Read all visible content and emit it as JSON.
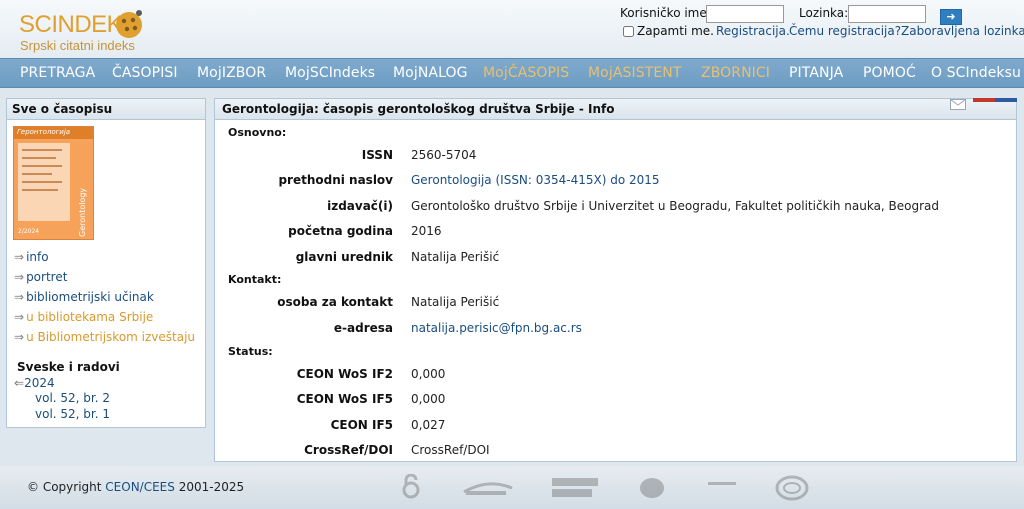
{
  "header": {
    "logo_main": "SCINDEKS",
    "logo_sub": "Srpski citatni indeks",
    "username_label": "Korisničko ime:",
    "password_label": "Lozinka:",
    "remember_label": "Zapamti me.",
    "links": [
      "Registracija.",
      "Čemu registracija?",
      "Zaboravljena lozinka!"
    ]
  },
  "nav": {
    "items": [
      {
        "label": "PRETRAGA"
      },
      {
        "label": "ČASOPISI"
      },
      {
        "label": "MojIZBOR"
      },
      {
        "label": "MojSCIndeks"
      },
      {
        "label": "MojNALOG"
      },
      {
        "label": "MojČASOPIS"
      },
      {
        "label": "MojASISTENT"
      },
      {
        "label": "ZBORNICI"
      },
      {
        "label": "PITANJA"
      },
      {
        "label": "POMOĆ"
      },
      {
        "label": "O SCIndeksu"
      }
    ]
  },
  "sidebar": {
    "title": "Sve o časopisu",
    "cover": {
      "title": "Геронтологија",
      "vertical": "Gerontology",
      "year": "2/2024"
    },
    "links": [
      {
        "label": "info"
      },
      {
        "label": "portret"
      },
      {
        "label": "bibliometrijski učinak"
      },
      {
        "label": "u bibliotekama Srbije"
      },
      {
        "label": "u Bibliometrijskom izveštaju"
      }
    ],
    "issues_heading": "Sveske i radovi",
    "year": "2024",
    "volumes": [
      "vol. 52, br. 2",
      "vol. 52, br. 1"
    ]
  },
  "main": {
    "title": "Gerontologija: časopis gerontološkog društva Srbije - Info",
    "sections": {
      "basic": "Osnovno:",
      "contact": "Kontakt:",
      "status": "Status:"
    },
    "rows": {
      "issn": {
        "label": "ISSN",
        "value": "2560-5704"
      },
      "prev_title": {
        "label": "prethodni naslov",
        "value": "Gerontologija (ISSN: 0354-415X) do 2015"
      },
      "publisher": {
        "label": "izdavač(i)",
        "value": "Gerontološko društvo Srbije i Univerzitet u Beogradu, Fakultet političkih nauka, Beograd"
      },
      "start_year": {
        "label": "početna godina",
        "value": "2016"
      },
      "editor": {
        "label": "glavni urednik",
        "value": "Natalija Perišić"
      },
      "contact_person": {
        "label": "osoba za kontakt",
        "value": "Natalija Perišić"
      },
      "email": {
        "label": "e-adresa",
        "value": "natalija.perisic@fpn.bg.ac.rs"
      },
      "wos_if2": {
        "label": "CEON WoS IF2",
        "value": "0,000"
      },
      "wos_if5": {
        "label": "CEON WoS IF5",
        "value": "0,000"
      },
      "ceon_if5": {
        "label": "CEON IF5",
        "value": "0,027"
      },
      "crossref": {
        "label": "CrossRef/DOI",
        "value": "CrossRef/DOI"
      }
    }
  },
  "footer": {
    "copyright_prefix": "© Copyright",
    "copyright_org": "CEON/CEES",
    "copyright_years": "2001-2025"
  },
  "colors": {
    "nav_bg": "#7faace",
    "link": "#1a4d80",
    "accent_orange": "#d89a2e",
    "logo": "#e0a030"
  }
}
